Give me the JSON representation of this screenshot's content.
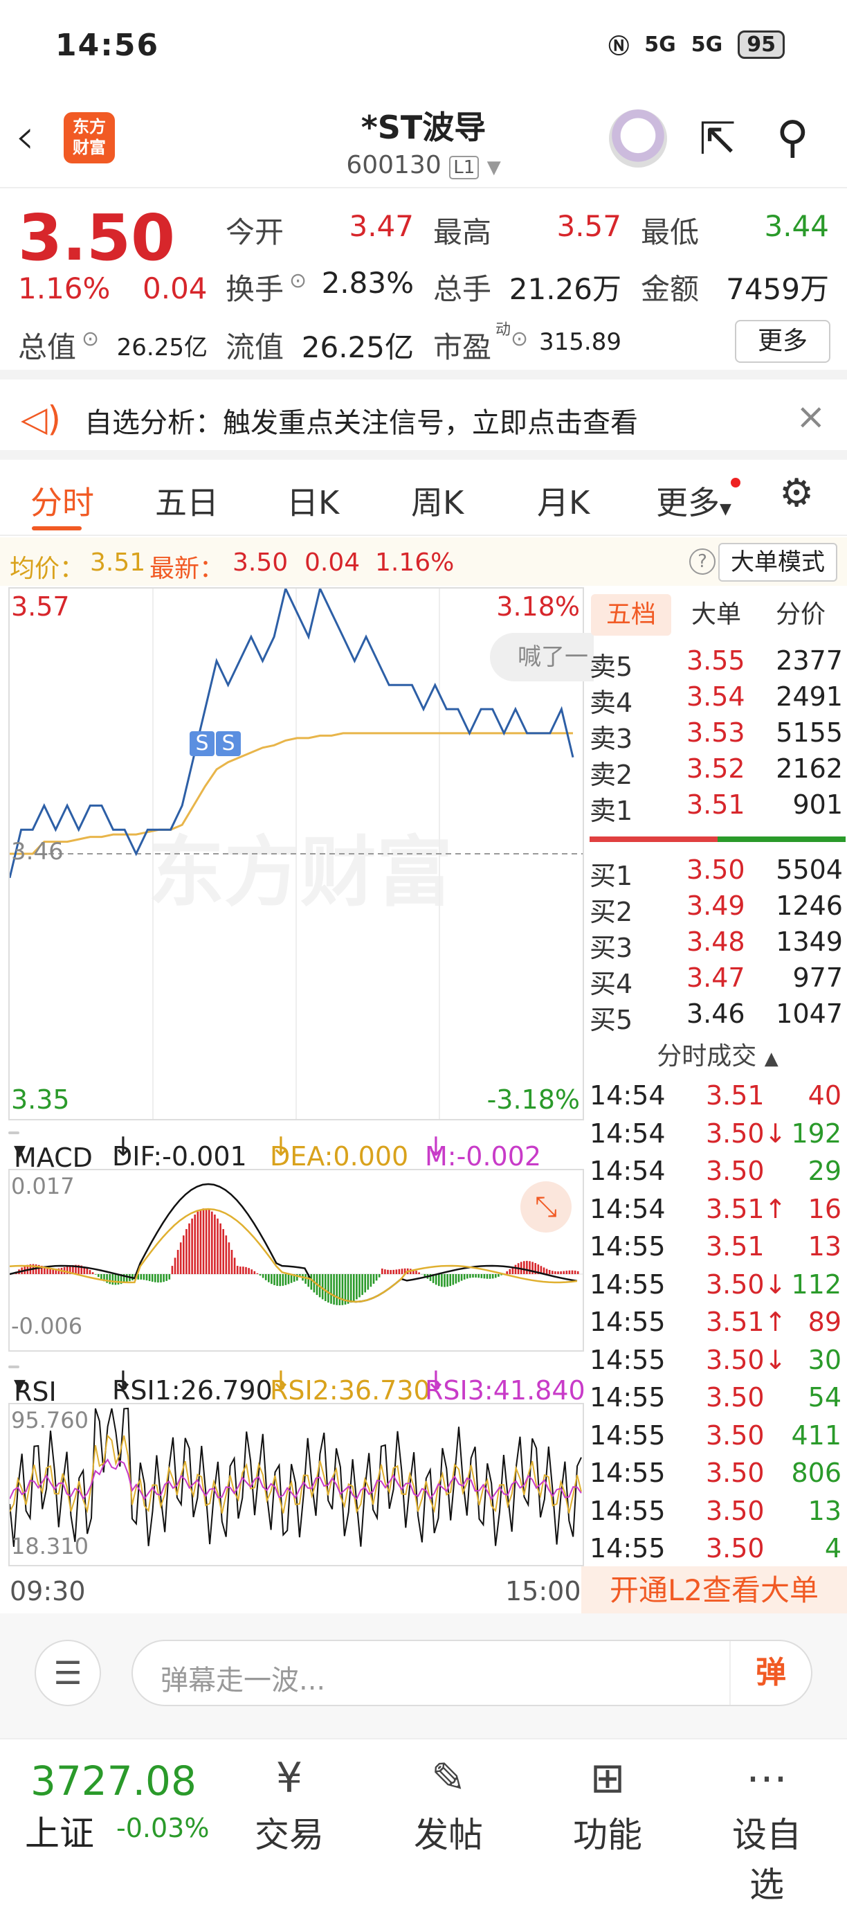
{
  "status": {
    "time": "14:56",
    "net1": "5G",
    "net2": "5G",
    "battery": "95"
  },
  "header": {
    "logo_line1": "东方",
    "logo_line2": "财富",
    "name": "*ST波导",
    "code": "600130",
    "level": "L1"
  },
  "quote": {
    "price": "3.50",
    "pct": "1.16%",
    "chg": "0.04",
    "open_label": "今开",
    "open": "3.47",
    "high_label": "最高",
    "high": "3.57",
    "low_label": "最低",
    "low": "3.44",
    "turnover_label": "换手",
    "turnover": "2.83%",
    "volume_label": "总手",
    "volume": "21.26万",
    "amount_label": "金额",
    "amount": "7459万",
    "mcap_label": "总值",
    "mcap": "26.25亿",
    "float_label": "流值",
    "float": "26.25亿",
    "pe_label": "市盈",
    "pe_sup": "动",
    "pe": "315.89",
    "more": "更多"
  },
  "banner": {
    "text": "自选分析：触发重点关注信号，立即点击查看"
  },
  "tabs": [
    "分时",
    "五日",
    "日K",
    "周K",
    "月K",
    "更多"
  ],
  "legend": {
    "avg_label": "均价：",
    "avg": "3.51",
    "last_label": "最新：",
    "last": "3.50",
    "chg": "0.04",
    "pct": "1.16%",
    "mode": "大单模式",
    "help": "?"
  },
  "chart": {
    "max": "3.57",
    "max_pct": "3.18%",
    "min": "3.35",
    "min_pct": "-3.18%",
    "prev": "3.46",
    "watermark": "东方财富",
    "hanle": "喊了一",
    "s": "S",
    "start": "09:30",
    "end": "15:00"
  },
  "chart_data": {
    "type": "line",
    "title": "",
    "x_range": [
      "09:30",
      "15:00"
    ],
    "ylim": [
      3.35,
      3.57
    ],
    "prev_close": 3.46,
    "series": [
      {
        "name": "",
        "values": [
          3.45,
          3.47,
          3.47,
          3.48,
          3.47,
          3.48,
          3.47,
          3.48,
          3.48,
          3.47,
          3.47,
          3.46,
          3.47,
          3.47,
          3.47,
          3.48,
          3.5,
          3.52,
          3.54,
          3.53,
          3.54,
          3.55,
          3.54,
          3.55,
          3.57,
          3.56,
          3.55,
          3.57,
          3.56,
          3.55,
          3.54,
          3.55,
          3.54,
          3.53,
          3.53,
          3.53,
          3.52,
          3.53,
          3.52,
          3.52,
          3.51,
          3.52,
          3.52,
          3.51,
          3.52,
          3.51,
          3.51,
          3.51,
          3.52,
          3.5
        ]
      },
      {
        "name": "",
        "values": [
          3.46,
          3.46,
          3.46,
          3.465,
          3.465,
          3.465,
          3.466,
          3.467,
          3.467,
          3.468,
          3.468,
          3.468,
          3.469,
          3.47,
          3.47,
          3.472,
          3.48,
          3.488,
          3.495,
          3.498,
          3.5,
          3.502,
          3.504,
          3.505,
          3.507,
          3.508,
          3.508,
          3.509,
          3.509,
          3.51,
          3.51,
          3.51,
          3.51,
          3.51,
          3.51,
          3.51,
          3.51,
          3.51,
          3.51,
          3.51,
          3.51,
          3.51,
          3.51,
          3.51,
          3.51,
          3.51,
          3.51,
          3.51,
          3.51,
          3.51
        ]
      }
    ]
  },
  "macd": {
    "label": "MACD",
    "dif": "DIF:-0.001",
    "dea": "DEA:0.000",
    "m": "M:-0.002",
    "top": "0.017",
    "bottom": "-0.006"
  },
  "rsi": {
    "label": "RSI",
    "rsi1": "RSI1:26.790",
    "rsi2": "RSI2:36.730",
    "rsi3": "RSI3:41.840",
    "top": "95.760",
    "bottom": "18.310"
  },
  "book": {
    "tabs": [
      "五档",
      "大单",
      "分价"
    ],
    "asks": [
      {
        "k": "卖5",
        "p": "3.55",
        "v": "2377"
      },
      {
        "k": "卖4",
        "p": "3.54",
        "v": "2491"
      },
      {
        "k": "卖3",
        "p": "3.53",
        "v": "5155"
      },
      {
        "k": "卖2",
        "p": "3.52",
        "v": "2162"
      },
      {
        "k": "卖1",
        "p": "3.51",
        "v": "901"
      }
    ],
    "bids": [
      {
        "k": "买1",
        "p": "3.50",
        "v": "5504"
      },
      {
        "k": "买2",
        "p": "3.49",
        "v": "1246"
      },
      {
        "k": "买3",
        "p": "3.48",
        "v": "1349"
      },
      {
        "k": "买4",
        "p": "3.47",
        "v": "977"
      },
      {
        "k": "买5",
        "p": "3.46",
        "v": "1047"
      }
    ],
    "ticks_title": "分时成交",
    "ticks": [
      {
        "t": "14:54",
        "p": "3.51",
        "v": "40",
        "c": "red",
        "vc": "red"
      },
      {
        "t": "14:54",
        "p": "3.50↓",
        "v": "192",
        "c": "red",
        "vc": "grn"
      },
      {
        "t": "14:54",
        "p": "3.50",
        "v": "29",
        "c": "red",
        "vc": "grn"
      },
      {
        "t": "14:54",
        "p": "3.51↑",
        "v": "16",
        "c": "red",
        "vc": "red"
      },
      {
        "t": "14:55",
        "p": "3.51",
        "v": "13",
        "c": "red",
        "vc": "red"
      },
      {
        "t": "14:55",
        "p": "3.50↓",
        "v": "112",
        "c": "red",
        "vc": "grn"
      },
      {
        "t": "14:55",
        "p": "3.51↑",
        "v": "89",
        "c": "red",
        "vc": "red"
      },
      {
        "t": "14:55",
        "p": "3.50↓",
        "v": "30",
        "c": "red",
        "vc": "grn"
      },
      {
        "t": "14:55",
        "p": "3.50",
        "v": "54",
        "c": "red",
        "vc": "grn"
      },
      {
        "t": "14:55",
        "p": "3.50",
        "v": "411",
        "c": "red",
        "vc": "grn"
      },
      {
        "t": "14:55",
        "p": "3.50",
        "v": "806",
        "c": "red",
        "vc": "grn"
      },
      {
        "t": "14:55",
        "p": "3.50",
        "v": "13",
        "c": "red",
        "vc": "grn"
      },
      {
        "t": "14:55",
        "p": "3.50",
        "v": "4",
        "c": "red",
        "vc": "grn"
      }
    ],
    "l2": "开通L2查看大单"
  },
  "danmu": {
    "placeholder": "弹幕走一波...",
    "send": "弹"
  },
  "bottom": {
    "index_val": "3727.08",
    "index_name": "上证",
    "index_chg": "-0.03%",
    "nav": [
      "交易",
      "发帖",
      "功能",
      "设自选"
    ]
  }
}
